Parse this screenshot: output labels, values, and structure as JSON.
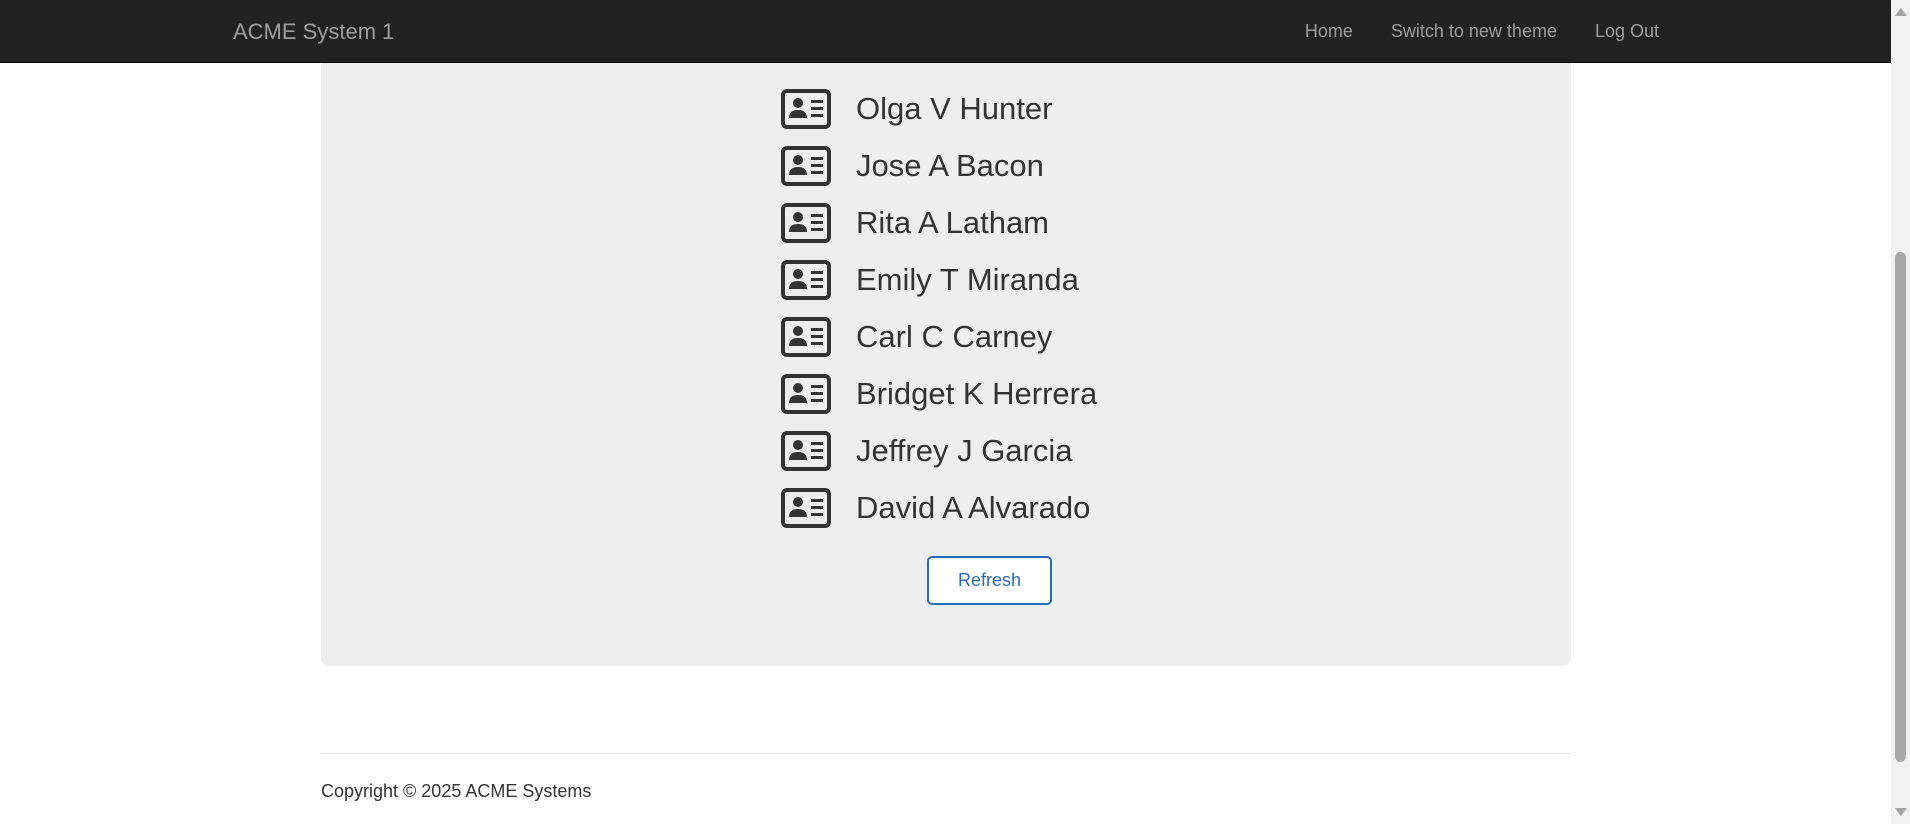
{
  "nav": {
    "brand": "ACME System 1",
    "links": [
      "Home",
      "Switch to new theme",
      "Log Out"
    ]
  },
  "people": [
    {
      "name": "Olga V Hunter",
      "icon": "id-card-icon"
    },
    {
      "name": "Jose A Bacon",
      "icon": "id-card-icon"
    },
    {
      "name": "Rita A Latham",
      "icon": "id-card-icon"
    },
    {
      "name": "Emily T Miranda",
      "icon": "id-card-icon"
    },
    {
      "name": "Carl C Carney",
      "icon": "id-card-icon"
    },
    {
      "name": "Bridget K Herrera",
      "icon": "id-card-icon"
    },
    {
      "name": "Jeffrey J Garcia",
      "icon": "id-card-icon"
    },
    {
      "name": "David A Alvarado",
      "icon": "id-card-icon"
    }
  ],
  "actions": {
    "refresh_label": "Refresh"
  },
  "footer": {
    "copyright": "Copyright © 2025 ACME Systems"
  },
  "colors": {
    "navbar_bg": "#222222",
    "nav_text": "#9d9d9d",
    "panel_bg": "#eeeeee",
    "accent": "#2a6db6",
    "text": "#333333"
  }
}
